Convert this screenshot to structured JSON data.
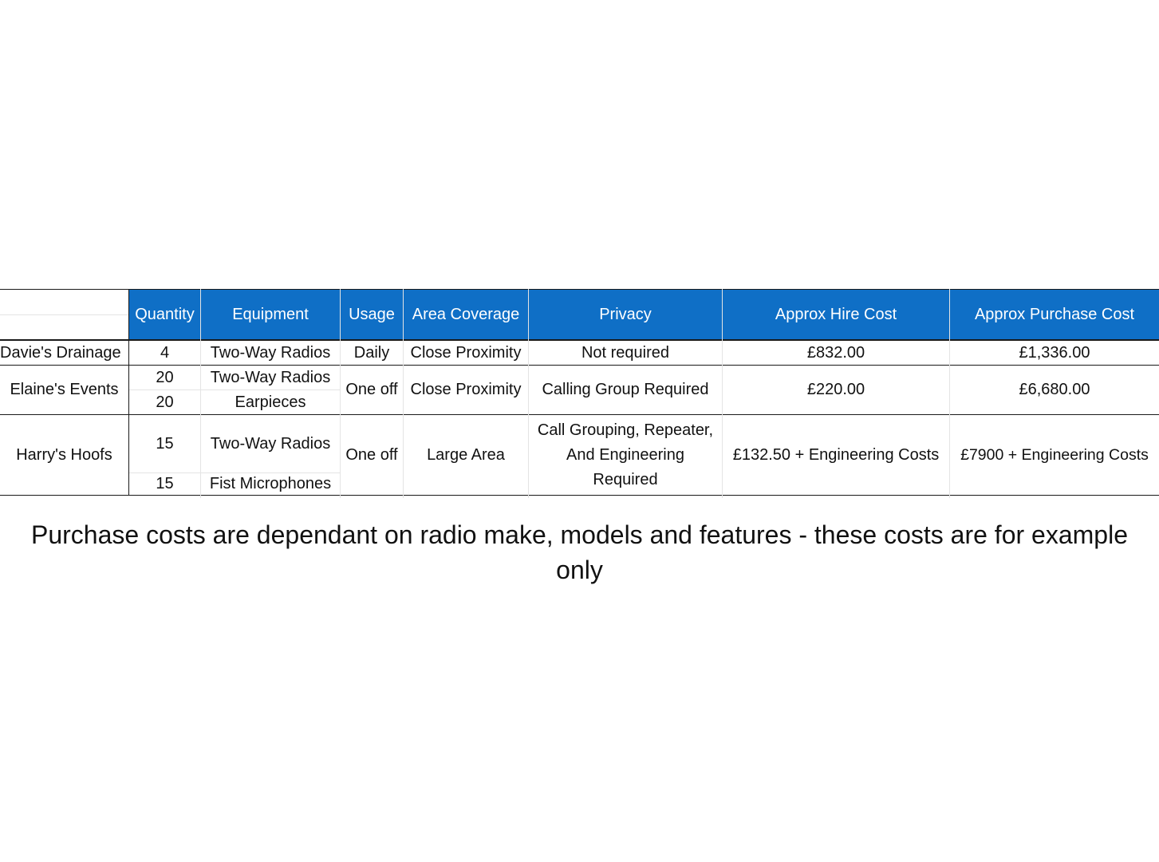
{
  "table": {
    "headers": {
      "quantity": "Quantity",
      "equipment": "Equipment",
      "usage": "Usage",
      "area": "Area Coverage",
      "privacy": "Privacy",
      "hire": "Approx Hire Cost",
      "purchase": "Approx Purchase Cost"
    },
    "rows": [
      {
        "customer": "Davie's Drainage",
        "items": [
          {
            "quantity": "4",
            "equipment": "Two-Way Radios"
          }
        ],
        "usage": "Daily",
        "area": "Close Proximity",
        "privacy": "Not required",
        "hire": "£832.00",
        "purchase": "£1,336.00"
      },
      {
        "customer": "Elaine's Events",
        "items": [
          {
            "quantity": "20",
            "equipment": "Two-Way Radios"
          },
          {
            "quantity": "20",
            "equipment": "Earpieces"
          }
        ],
        "usage": "One off",
        "area": "Close Proximity",
        "privacy": "Calling Group Required",
        "hire": "£220.00",
        "purchase": "£6,680.00"
      },
      {
        "customer": "Harry's Hoofs",
        "items": [
          {
            "quantity": "15",
            "equipment": "Two-Way Radios"
          },
          {
            "quantity": "15",
            "equipment": "Fist Microphones"
          }
        ],
        "usage": "One off",
        "area": "Large Area",
        "privacy_lines": [
          "Call Grouping, Repeater,",
          "And Engineering",
          "Required"
        ],
        "hire": "£132.50 + Engineering Costs",
        "purchase": "£7900 + Engineering Costs"
      }
    ]
  },
  "note": "Purchase costs are dependant on radio make, models and features - these costs are for example only",
  "colors": {
    "header_bg": "#0f6fc6",
    "header_text": "#ffffff",
    "border": "#1a1a1a"
  }
}
